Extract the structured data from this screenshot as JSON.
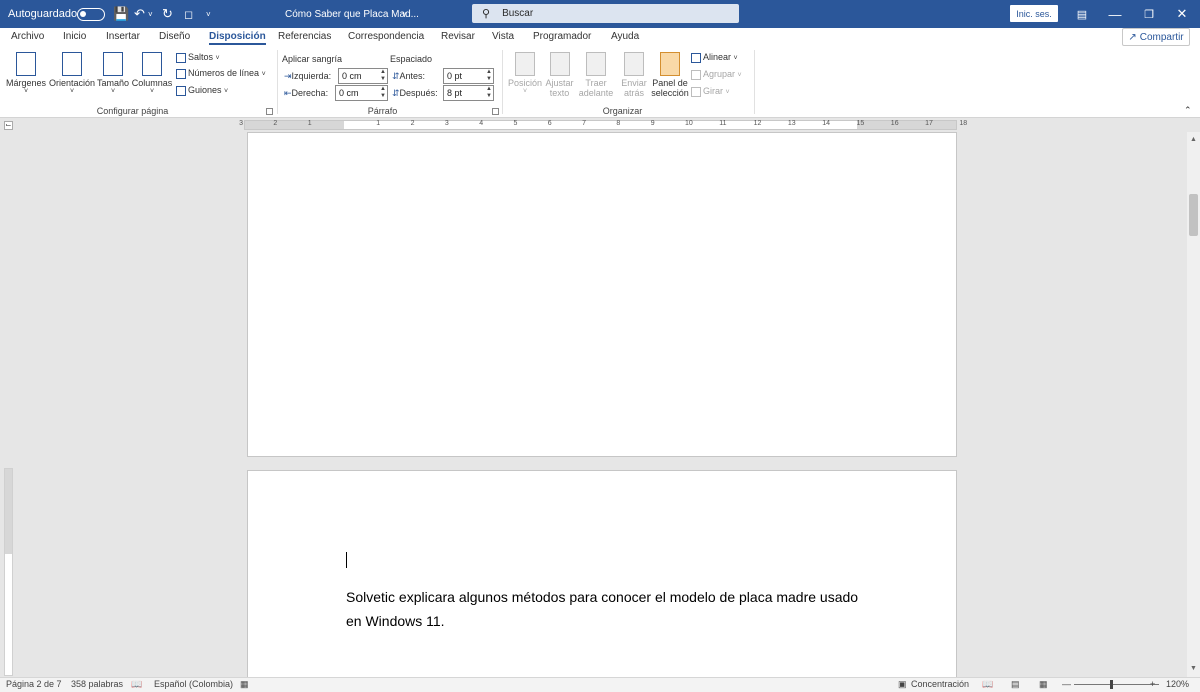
{
  "titlebar": {
    "autosave_label": "Autoguardado",
    "doc_title": "Cómo Saber que Placa Mad...",
    "search_placeholder": "Buscar",
    "signin_label": "Inic. ses."
  },
  "tabs": [
    "Archivo",
    "Inicio",
    "Insertar",
    "Diseño",
    "Disposición",
    "Referencias",
    "Correspondencia",
    "Revisar",
    "Vista",
    "Programador",
    "Ayuda"
  ],
  "active_tab": "Disposición",
  "share_label": "Compartir",
  "ribbon": {
    "page_setup": {
      "margins": "Márgenes",
      "orientation": "Orientación",
      "size": "Tamaño",
      "columns": "Columnas",
      "breaks": "Saltos",
      "line_numbers": "Números de línea",
      "hyphenation": "Guiones",
      "group_label": "Configurar página"
    },
    "paragraph": {
      "indent_title": "Aplicar sangría",
      "left_label": "Izquierda:",
      "left_value": "0 cm",
      "right_label": "Derecha:",
      "right_value": "0 cm",
      "spacing_title": "Espaciado",
      "before_label": "Antes:",
      "before_value": "0 pt",
      "after_label": "Después:",
      "after_value": "8 pt",
      "group_label": "Párrafo"
    },
    "arrange": {
      "position_1": "Posición",
      "wrap_1": "Ajustar",
      "wrap_2": "texto",
      "forward_1": "Traer",
      "forward_2": "adelante",
      "backward_1": "Enviar",
      "backward_2": "atrás",
      "selection_1": "Panel de",
      "selection_2": "selección",
      "align": "Alinear",
      "group": "Agrupar",
      "rotate": "Girar",
      "group_label": "Organizar"
    }
  },
  "ruler_labels": [
    "3",
    "2",
    "1",
    "1",
    "2",
    "3",
    "4",
    "5",
    "6",
    "7",
    "8",
    "9",
    "10",
    "11",
    "12",
    "13",
    "14",
    "15",
    "16",
    "17",
    "18"
  ],
  "document": {
    "paragraph_line1": "Solvetic explicara algunos métodos para conocer el modelo de placa madre usado",
    "paragraph_line2": "en Windows 11."
  },
  "statusbar": {
    "page": "Página 2 de 7",
    "words": "358 palabras",
    "language": "Español (Colombia)",
    "focus": "Concentración",
    "zoom": "120%"
  },
  "colors": {
    "accent": "#2b579a",
    "canvas": "#e6e6e6"
  }
}
